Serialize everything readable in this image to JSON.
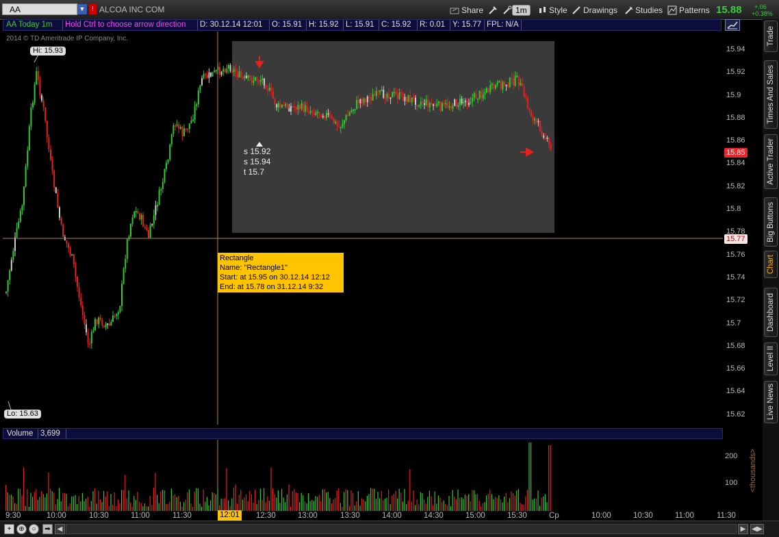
{
  "toolbar": {
    "symbol": "AA",
    "company": "ALCOA INC COM",
    "share": "Share",
    "timeframe": "1m",
    "style": "Style",
    "drawings": "Drawings",
    "studies": "Studies",
    "patterns": "Patterns",
    "last_price": "15.88",
    "change": "+.06",
    "change_pct": "+0.38%"
  },
  "infobar": {
    "symbol_period": "AA Today 1m",
    "hint": "Hold Ctrl to choose arrow direction",
    "date": "D: 30.12.14 12:01",
    "open": "O: 15.91",
    "high": "H: 15.92",
    "low": "L: 15.91",
    "close": "C: 15.92",
    "range": "R: 0.01",
    "y": "Y: 15.77",
    "fpl": "FPL: N/A"
  },
  "chart": {
    "copyright": "2014 © TD Ameritrade IP Company, Inc.",
    "hi_label": "Hi: 15.93",
    "lo_label": "Lo: 15.63",
    "last_tag": "15.85",
    "crosshair_tag": "15.77",
    "price_ticks": [
      "15.94",
      "15.92",
      "15.9",
      "15.88",
      "15.86",
      "15.84",
      "15.82",
      "15.8",
      "15.78",
      "15.76",
      "15.74",
      "15.72",
      "15.7",
      "15.68",
      "15.66",
      "15.64",
      "15.62"
    ],
    "note_lines": [
      "s 15.92",
      "s 15.94",
      "t 15.7"
    ],
    "tooltip": {
      "title": "Rectangle",
      "name": "Name: \"Rectangle1\"",
      "start": "Start: at 15.95 on 30.12.14 12:12",
      "end": "End: at 15.78 on 31.12.14 9:32"
    },
    "colors": {
      "up": "#2ecc2e",
      "down": "#e82020",
      "neutral": "#d0d0d0",
      "rectangle": "#3a3a3a",
      "cursor": "#c8a060"
    }
  },
  "volume": {
    "label": "Volume",
    "value": "3,699",
    "units": "<thousands>",
    "ticks": [
      "200",
      "100"
    ]
  },
  "time_axis": {
    "labels": [
      "9:30",
      "10:00",
      "10:30",
      "11:00",
      "11:30",
      "12:30",
      "13:00",
      "13:30",
      "14:00",
      "14:30",
      "15:00",
      "15:30",
      "Cp",
      "10:00",
      "10:30",
      "11:00",
      "11:30"
    ],
    "cursor": "12:01"
  },
  "right_tabs": [
    "Trade",
    "Times And Sales",
    "Active Trader",
    "Big Buttons",
    "Chart",
    "Dashboard",
    "Level II",
    "Live News"
  ],
  "right_tabs_active": "Chart",
  "icons": {
    "share": "share-icon",
    "zoom_in": "zoom-in-icon",
    "zoom_out": "magnifier-icon",
    "scroll_right": "scroll-right-icon"
  }
}
